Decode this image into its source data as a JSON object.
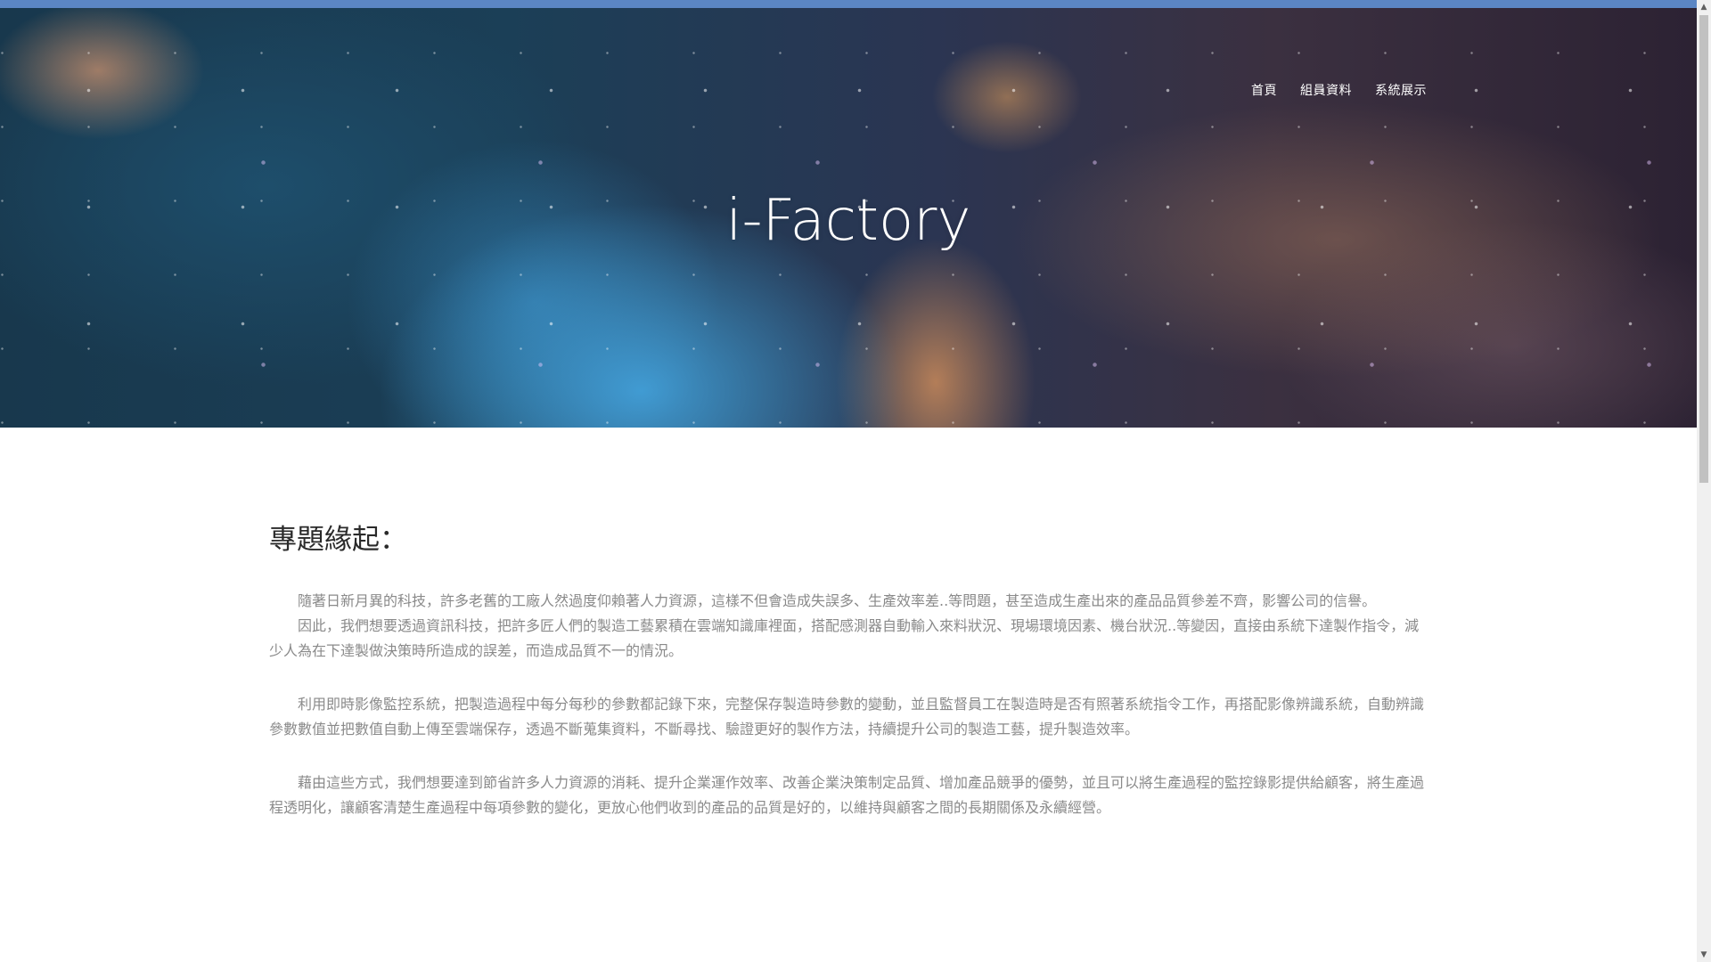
{
  "nav": {
    "items": [
      {
        "label": "首頁"
      },
      {
        "label": "組員資料"
      },
      {
        "label": "系統展示"
      }
    ]
  },
  "hero": {
    "title": "i-Factory"
  },
  "content": {
    "heading": "專題緣起：",
    "paragraphs": [
      "隨著日新月異的科技，許多老舊的工廠人然過度仰賴著人力資源，這樣不但會造成失誤多、生產效率差..等問題，甚至造成生產出來的產品品質參差不齊，影響公司的信譽。",
      "因此，我們想要透過資訊科技，把許多匠人們的製造工藝累積在雲端知識庫裡面，搭配感測器自動輸入來料狀況、現場環境因素、機台狀況..等變因，直接由系統下達製作指令，減少人為在下達製做決策時所造成的誤差，而造成品質不一的情況。",
      "利用即時影像監控系統，把製造過程中每分每秒的參數都記錄下來，完整保存製造時參數的變動，並且監督員工在製造時是否有照著系統指令工作，再搭配影像辨識系統，自動辨識參數數值並把數值自動上傳至雲端保存，透過不斷蒐集資料，不斷尋找、驗證更好的製作方法，持續提升公司的製造工藝，提升製造效率。",
      "藉由這些方式，我們想要達到節省許多人力資源的消耗、提升企業運作效率、改善企業決策制定品質、增加產品競爭的優勢，並且可以將生產過程的監控錄影提供給顧客，將生產過程透明化，讓顧客清楚生產過程中每項參數的變化，更放心他們收到的產品的品質是好的，以維持與顧客之間的長期關係及永續經營。"
    ]
  },
  "colors": {
    "top_strip": "#5b86c4",
    "heading": "#2a2a2a",
    "body_text": "#8a8a8a"
  },
  "icons": {
    "scroll_up": "triangle-up-icon",
    "scroll_down": "triangle-down-icon"
  }
}
